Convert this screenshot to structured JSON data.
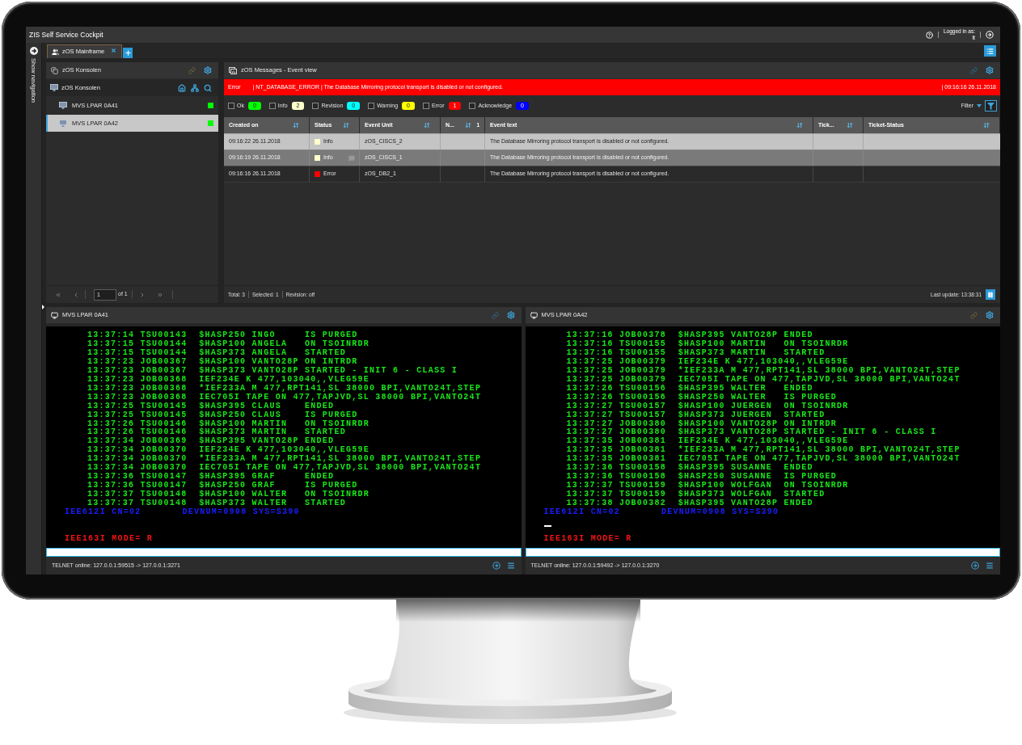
{
  "window": {
    "title": "ZIS Self Service Cockpit",
    "logged_in_label": "Logged in as:",
    "user": "lt"
  },
  "navigation": {
    "label": "Show navigation"
  },
  "tabs": [
    {
      "label": "zOS Mainframe",
      "selected": true
    }
  ],
  "consoles_panel": {
    "title": "zOS Konsolen",
    "tree": {
      "label": "zOS Konsolen",
      "items": [
        {
          "label": "MVS LPAR 0A41",
          "selected": false,
          "color": "#00ff00"
        },
        {
          "label": "MVS LPAR 0A42",
          "selected": true,
          "color": "#00ff00"
        }
      ]
    },
    "pager": {
      "page": "1",
      "total": "of 1"
    }
  },
  "events_panel": {
    "title": "zOS Messages - Event view",
    "alert": {
      "kind": "error",
      "severity": "Error",
      "message": "| NT_DATABASE_ERROR | The Database Mirroring protocol transport is disabled or not configured.",
      "time": "| 09:16:16 26.11.2018"
    },
    "filters": [
      {
        "label": "Ok",
        "count": "0",
        "checked": false,
        "color": "#00ff00"
      },
      {
        "label": "Info",
        "count": "2",
        "checked": false,
        "color": "#ffffcc"
      },
      {
        "label": "Revision",
        "count": "0",
        "checked": false,
        "color": "#00ffff"
      },
      {
        "label": "Warning",
        "count": "0",
        "checked": false,
        "color": "#ffff00"
      },
      {
        "label": "Error",
        "count": "1",
        "checked": false,
        "color": "#ff0000"
      },
      {
        "label": "Acknowledge",
        "count": "0",
        "checked": false,
        "color": "#0000ff"
      }
    ],
    "filter_menu": "Filter",
    "table": {
      "columns": [
        {
          "label": "Created on"
        },
        {
          "label": "Status"
        },
        {
          "label": "Event Unit"
        },
        {
          "label": "N...",
          "sort_priority": "1"
        },
        {
          "label": "Event text"
        },
        {
          "label": "Tick..."
        },
        {
          "label": "Ticket-Status"
        }
      ],
      "rows": [
        {
          "selected": true,
          "highlighted": false,
          "note": false,
          "created_on": "09:16:22 26.11.2018",
          "status": {
            "label": "Info",
            "color": "#ffffcc"
          },
          "event_unit": "zOS_CISCS_2",
          "event_text": "The Database Mirroring protocol transport is disabled or not configured."
        },
        {
          "selected": false,
          "highlighted": true,
          "note": true,
          "created_on": "09:16:19 26.11.2018",
          "status": {
            "label": "Info",
            "color": "#ffffcc"
          },
          "event_unit": "zOS_CISCS_1",
          "event_text": "The Database Mirroring protocol transport is disabled or not configured."
        },
        {
          "selected": false,
          "highlighted": false,
          "note": false,
          "created_on": "09:16:16 26.11.2018",
          "status": {
            "label": "Error",
            "color": "#ff0000"
          },
          "event_unit": "zOS_DB2_1",
          "event_text": "The Database Mirroring protocol transport is disabled or not configured."
        }
      ]
    },
    "footer": {
      "stats": [
        "Total: 3",
        "Selected: 1",
        "Revision: off"
      ],
      "last_update": "Last update: 13:38:31"
    }
  },
  "terminals": [
    {
      "title": "MVS LPAR 0A41",
      "output": [
        "13:37:14 TSU00143  $HASP250 INGO     IS PURGED",
        "13:37:15 TSU00144  $HASP100 ANGELA   ON TSOINRDR",
        "13:37:15 TSU00144  $HASP373 ANGELA   STARTED",
        "13:37:23 JOB00367  $HASP100 VANTO28P ON INTRDR",
        "13:37:23 JOB00367  $HASP373 VANTO28P STARTED - INIT 6 - CLASS I",
        "13:37:23 JOB00368  IEF234E K 477,103040,,VLEG59E",
        "13:37:23 JOB00368  *IEF233A M 477,RPT141,SL 38000 BPI,VANTO24T,STEP",
        "13:37:23 JOB00368  IEC705I TAPE ON 477,TAPJVD,SL 38000 BPI,VANTO24T",
        "13:37:25 TSU00145  $HASP395 CLAUS    ENDED",
        "13:37:25 TSU00145  $HASP250 CLAUS    IS PURGED",
        "13:37:26 TSU00146  $HASP100 MARTIN   ON TSOINRDR",
        "13:37:26 TSU00146  $HASP373 MARTIN   STARTED",
        "13:37:34 JOB00369  $HASP395 VANTO28P ENDED",
        "13:37:34 JOB00370  IEF234E K 477,103040,,VLEG59E",
        "13:37:34 JOB00370  *IEF233A M 477,RPT141,SL 38000 BPI,VANTO24T,STEP",
        "13:37:34 JOB00370  IEC705I TAPE ON 477,TAPJVD,SL 38000 BPI,VANTO24T",
        "13:37:36 TSU00147  $HASP395 GRAF     ENDED",
        "13:37:36 TSU00147  $HASP250 GRAF     IS PURGED",
        "13:37:37 TSU00148  $HASP100 WALTER   ON TSOINRDR",
        "13:37:37 TSU00148  $HASP373 WALTER   STARTED"
      ],
      "system_line": "IEE612I CN=02       DEVNUM=0908 SYS=S390",
      "cursor": false,
      "mode_line": "IEE163I MODE= R",
      "status": "TELNET online: 127.0.0.1:59515 -> 127.0.0.1:3271"
    },
    {
      "title": "MVS LPAR 0A42",
      "output": [
        "13:37:16 JOB00378  $HASP395 VANTO28P ENDED",
        "13:37:16 TSU00155  $HASP100 MARTIN   ON TSOINRDR",
        "13:37:16 TSU00155  $HASP373 MARTIN   STARTED",
        "13:37:25 JOB00379  IEF234E K 477,103040,,VLEG59E",
        "13:37:25 JOB00379  *IEF233A M 477,RPT141,SL 38000 BPI,VANTO24T,STEP",
        "13:37:25 JOB00379  IEC705I TAPE ON 477,TAPJVD,SL 38000 BPI,VANTO24T",
        "13:37:26 TSU00156  $HASP395 WALTER   ENDED",
        "13:37:26 TSU00156  $HASP250 WALTER   IS PURGED",
        "13:37:27 TSU00157  $HASP100 JUERGEN  ON TSOINRDR",
        "13:37:27 TSU00157  $HASP373 JUERGEN  STARTED",
        "13:37:27 JOB00380  $HASP100 VANTO28P ON INTRDR",
        "13:37:27 JOB00380  $HASP373 VANTO28P STARTED - INIT 6 - CLASS I",
        "13:37:35 JOB00381  IEF234E K 477,103040,,VLEG59E",
        "13:37:35 JOB00381  *IEF233A M 477,RPT141,SL 38000 BPI,VANTO24T,STEP",
        "13:37:35 JOB00381  IEC705I TAPE ON 477,TAPJVD,SL 38000 BPI,VANTO24T",
        "13:37:36 TSU00158  $HASP395 SUSANNE  ENDED",
        "13:37:36 TSU00158  $HASP250 SUSANNE  IS PURGED",
        "13:37:37 TSU00159  $HASP100 WOLFGAN  ON TSOINRDR",
        "13:37:37 TSU00159  $HASP373 WOLFGAN  STARTED",
        "13:37:38 JOB00382  $HASP395 VANTO28P ENDED"
      ],
      "system_line": "IEE612I CN=02       DEVNUM=0908 SYS=S390",
      "cursor": true,
      "mode_line": "IEE163I MODE= R",
      "status": "TELNET online: 127.0.0.1:59492 -> 127.0.0.1:3270"
    }
  ]
}
